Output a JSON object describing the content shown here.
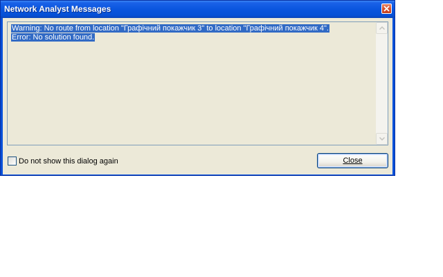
{
  "window": {
    "title": "Network Analyst Messages"
  },
  "messages": {
    "lines": [
      "Warning: No route from location \"Графічний покажчик 3\" to location \"Графічний покажчик 4\".",
      "Error: No solution found."
    ]
  },
  "footer": {
    "checkbox_label": "Do not show this dialog again",
    "checkbox_checked": false,
    "close_label": "Close"
  },
  "icons": {
    "title_close": "close-icon",
    "scroll_up": "arrow-up-icon",
    "scroll_down": "arrow-down-icon"
  },
  "colors": {
    "titlebar": "#0a55de",
    "selection": "#316ac5",
    "dialog_face": "#ece9d8",
    "title_close": "#d9502c"
  }
}
